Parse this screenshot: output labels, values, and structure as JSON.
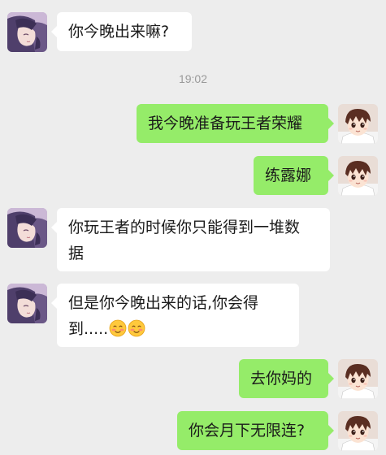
{
  "timestamp": "19:02",
  "messages": [
    {
      "side": "left",
      "text": "你今晚出来嘛?"
    },
    {
      "side": "right",
      "text": "我今晚准备玩王者荣耀"
    },
    {
      "side": "right",
      "text": "练露娜"
    },
    {
      "side": "left",
      "text_line1": "你玩王者的时候你只能得到一堆数",
      "text_line2": "据"
    },
    {
      "side": "left",
      "text_line1": "但是你今晚出来的话,你会得",
      "text_line2": "到....."
    },
    {
      "side": "right",
      "text": "去你妈的"
    },
    {
      "side": "right",
      "text": "你会月下无限连?"
    }
  ],
  "icons": {
    "left_avatar": "girl-anime-avatar",
    "right_avatar": "boy-anime-avatar",
    "emoji": "blushing-smile-emoji"
  },
  "colors": {
    "background": "#ededed",
    "outgoing_bubble": "#95ec69",
    "incoming_bubble": "#ffffff"
  }
}
